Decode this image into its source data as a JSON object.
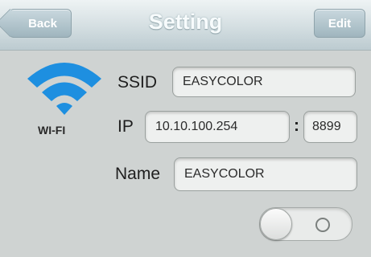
{
  "header": {
    "title": "Setting",
    "back_label": "Back",
    "edit_label": "Edit"
  },
  "wifi": {
    "icon": "wifi-icon",
    "label": "WI-FI",
    "color": "#1e8fe0"
  },
  "form": {
    "ssid_label": "SSID",
    "ssid_value": "EASYCOLOR",
    "ip_label": "IP",
    "ip_value": "10.10.100.254",
    "separator": ":",
    "port_value": "8899",
    "name_label": "Name",
    "name_value": "EASYCOLOR"
  },
  "toggle": {
    "state": "off"
  }
}
